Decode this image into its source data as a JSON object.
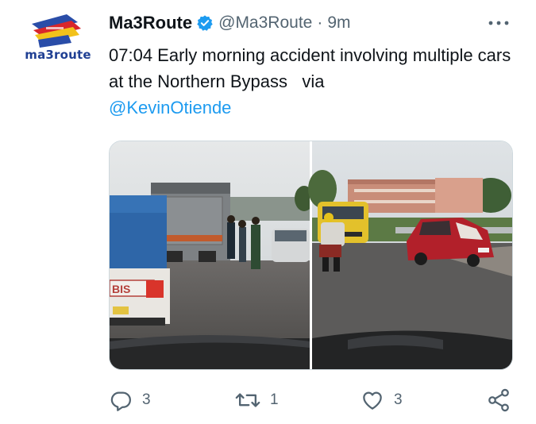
{
  "author": {
    "display_name": "Ma3Route",
    "handle": "@Ma3Route",
    "separator": "·",
    "time": "9m",
    "logo_text": "ma3route"
  },
  "tweet": {
    "text": "07:04 Early morning accident involving multiple cars at the Northern Bypass",
    "via": "via",
    "mention": "@KevinOtiende"
  },
  "media": {
    "photo_left_plate": "BIS"
  },
  "actions": {
    "reply_count": "3",
    "retweet_count": "1",
    "like_count": "3"
  },
  "colors": {
    "accent": "#1d9bf0",
    "text": "#0f1419",
    "secondary": "#536471",
    "logo_blue": "#1f3f93"
  },
  "icons": {
    "verified": "verified-badge-icon",
    "more": "more-dots-icon",
    "reply": "reply-icon",
    "retweet": "retweet-icon",
    "like": "heart-icon",
    "share": "share-icon"
  }
}
